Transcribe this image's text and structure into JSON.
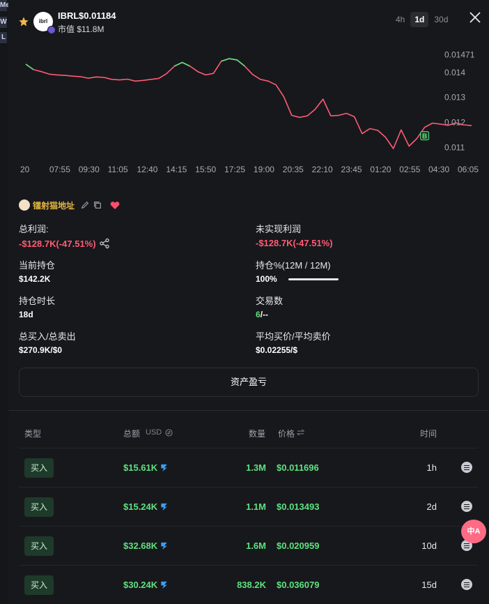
{
  "left_tags": [
    "Me",
    "W",
    "L"
  ],
  "header": {
    "token_name": "IBRL",
    "price": "$0.01184",
    "logo_text": "ibrl",
    "market_cap": "市值 $11.8M",
    "timeframes": [
      "4h",
      "1d",
      "30d"
    ],
    "active_timeframe": "1d"
  },
  "chart_data": {
    "type": "line",
    "x_ticks": [
      "20",
      "07:55",
      "09:30",
      "11:05",
      "12:40",
      "14:15",
      "15:50",
      "17:25",
      "19:00",
      "20:35",
      "22:10",
      "23:45",
      "01:20",
      "02:55",
      "04:30",
      "06:05"
    ],
    "y_ticks": [
      "0.01471",
      "0.014",
      "0.013",
      "0.012",
      "0.011"
    ],
    "ylim": [
      0.0107,
      0.015
    ],
    "y": [
      0.01433,
      0.01411,
      0.01403,
      0.01393,
      0.0139,
      0.01388,
      0.01385,
      0.01383,
      0.01377,
      0.01382,
      0.0138,
      0.01372,
      0.0137,
      0.01373,
      0.01365,
      0.01368,
      0.01372,
      0.01376,
      0.01395,
      0.01425,
      0.0144,
      0.01425,
      0.01403,
      0.0139,
      0.01396,
      0.01445,
      0.01455,
      0.0145,
      0.01425,
      0.01392,
      0.01372,
      0.01365,
      0.0135,
      0.01302,
      0.01228,
      0.0122,
      0.01226,
      0.01252,
      0.01293,
      0.01226,
      0.01228,
      0.01236,
      0.01223,
      0.01155,
      0.01175,
      0.01168,
      0.0114,
      0.01095,
      0.0117,
      0.01105,
      0.01135,
      0.0118,
      0.01197,
      0.01193,
      0.01188,
      0.01198,
      0.0119,
      0.01187
    ],
    "line_color": "#ff5c74",
    "up_color": "#5ee27f",
    "grid": false,
    "marker_label": "B"
  },
  "wallet": {
    "label": "镭射猫地址"
  },
  "stats": {
    "total_profit_label": "总利润:",
    "total_profit_value": "-$128.7K(-47.51%)",
    "unrealized_label": "未实现利润",
    "unrealized_value": "-$128.7K(-47.51%)",
    "holding_label": "当前持仓",
    "holding_value": "$142.2K",
    "holding_pct_label": "持仓%(12M / 12M)",
    "holding_pct_value": "100%",
    "holding_pct_fill": 1.0,
    "hold_time_label": "持仓时长",
    "hold_time_value": "18d",
    "trades_label": "交易数",
    "trades_buy": "6",
    "trades_sell": "/--",
    "total_buysell_label": "总买入/总卖出",
    "total_buysell_value": "$270.9K/$0",
    "avg_price_label": "平均买价/平均卖价",
    "avg_price_value": "$0.02255/$"
  },
  "asset_pnl_button": "资产盈亏",
  "table": {
    "headers": {
      "type": "类型",
      "amount": "总额",
      "currency": "USD",
      "qty": "数量",
      "price": "价格",
      "time": "时间"
    },
    "rows": [
      {
        "type": "买入",
        "amount": "$15.61K",
        "qty": "1.3M",
        "price": "$0.011696",
        "time": "1h"
      },
      {
        "type": "买入",
        "amount": "$15.24K",
        "qty": "1.1M",
        "price": "$0.013493",
        "time": "2d"
      },
      {
        "type": "买入",
        "amount": "$32.68K",
        "qty": "1.6M",
        "price": "$0.020959",
        "time": "10d"
      },
      {
        "type": "买入",
        "amount": "$30.24K",
        "qty": "838.2K",
        "price": "$0.036079",
        "time": "15d"
      }
    ]
  },
  "translate_button": "中A"
}
